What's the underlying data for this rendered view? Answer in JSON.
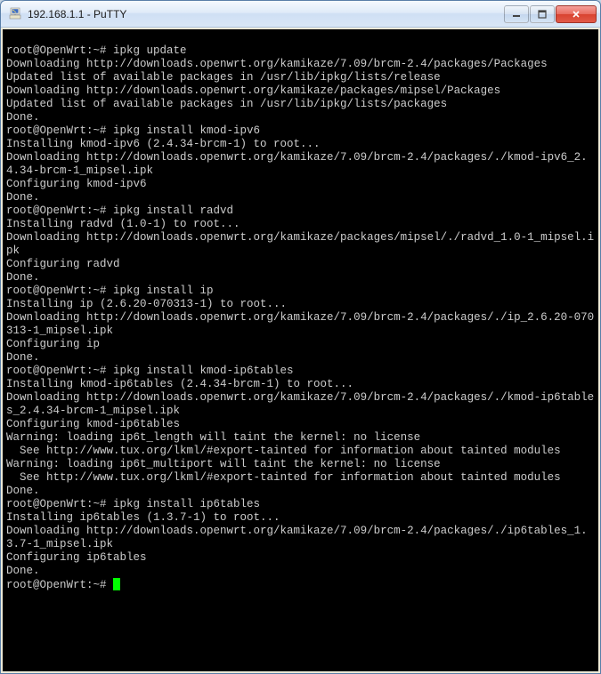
{
  "window": {
    "title": "192.168.1.1 - PuTTY",
    "icons": {
      "app": "putty-icon",
      "minimize": "minimize-icon",
      "maximize": "maximize-icon",
      "close": "close-icon"
    }
  },
  "terminal": {
    "lines": [
      "",
      "root@OpenWrt:~# ipkg update",
      "Downloading http://downloads.openwrt.org/kamikaze/7.09/brcm-2.4/packages/Packages",
      "Updated list of available packages in /usr/lib/ipkg/lists/release",
      "Downloading http://downloads.openwrt.org/kamikaze/packages/mipsel/Packages",
      "Updated list of available packages in /usr/lib/ipkg/lists/packages",
      "Done.",
      "root@OpenWrt:~# ipkg install kmod-ipv6",
      "Installing kmod-ipv6 (2.4.34-brcm-1) to root...",
      "Downloading http://downloads.openwrt.org/kamikaze/7.09/brcm-2.4/packages/./kmod-ipv6_2.4.34-brcm-1_mipsel.ipk",
      "Configuring kmod-ipv6",
      "Done.",
      "root@OpenWrt:~# ipkg install radvd",
      "Installing radvd (1.0-1) to root...",
      "Downloading http://downloads.openwrt.org/kamikaze/packages/mipsel/./radvd_1.0-1_mipsel.ipk",
      "Configuring radvd",
      "Done.",
      "root@OpenWrt:~# ipkg install ip",
      "Installing ip (2.6.20-070313-1) to root...",
      "Downloading http://downloads.openwrt.org/kamikaze/7.09/brcm-2.4/packages/./ip_2.6.20-070313-1_mipsel.ipk",
      "Configuring ip",
      "Done.",
      "root@OpenWrt:~# ipkg install kmod-ip6tables",
      "Installing kmod-ip6tables (2.4.34-brcm-1) to root...",
      "Downloading http://downloads.openwrt.org/kamikaze/7.09/brcm-2.4/packages/./kmod-ip6tables_2.4.34-brcm-1_mipsel.ipk",
      "Configuring kmod-ip6tables",
      "Warning: loading ip6t_length will taint the kernel: no license",
      "  See http://www.tux.org/lkml/#export-tainted for information about tainted modules",
      "Warning: loading ip6t_multiport will taint the kernel: no license",
      "  See http://www.tux.org/lkml/#export-tainted for information about tainted modules",
      "Done.",
      "root@OpenWrt:~# ipkg install ip6tables",
      "Installing ip6tables (1.3.7-1) to root...",
      "Downloading http://downloads.openwrt.org/kamikaze/7.09/brcm-2.4/packages/./ip6tables_1.3.7-1_mipsel.ipk",
      "Configuring ip6tables",
      "Done.",
      "root@OpenWrt:~# "
    ]
  }
}
